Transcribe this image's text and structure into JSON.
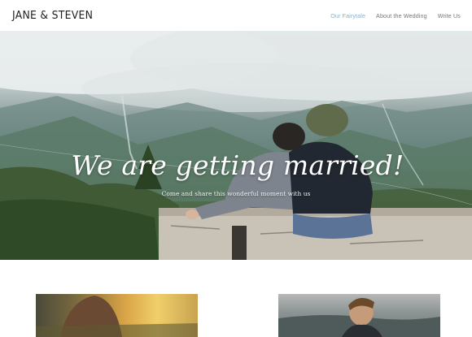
{
  "header": {
    "logo": "JANE & STEVEN",
    "nav": [
      {
        "label": "Our Fairytale",
        "active": true
      },
      {
        "label": "About the Wedding",
        "active": false
      },
      {
        "label": "Write Us",
        "active": false
      }
    ]
  },
  "hero": {
    "title": "We are getting married!",
    "subtitle": "Come and share this wonderful moment with us"
  },
  "colors": {
    "nav_active": "#7fb3d3",
    "nav_default": "#777777",
    "logo": "#1e1e1e"
  }
}
